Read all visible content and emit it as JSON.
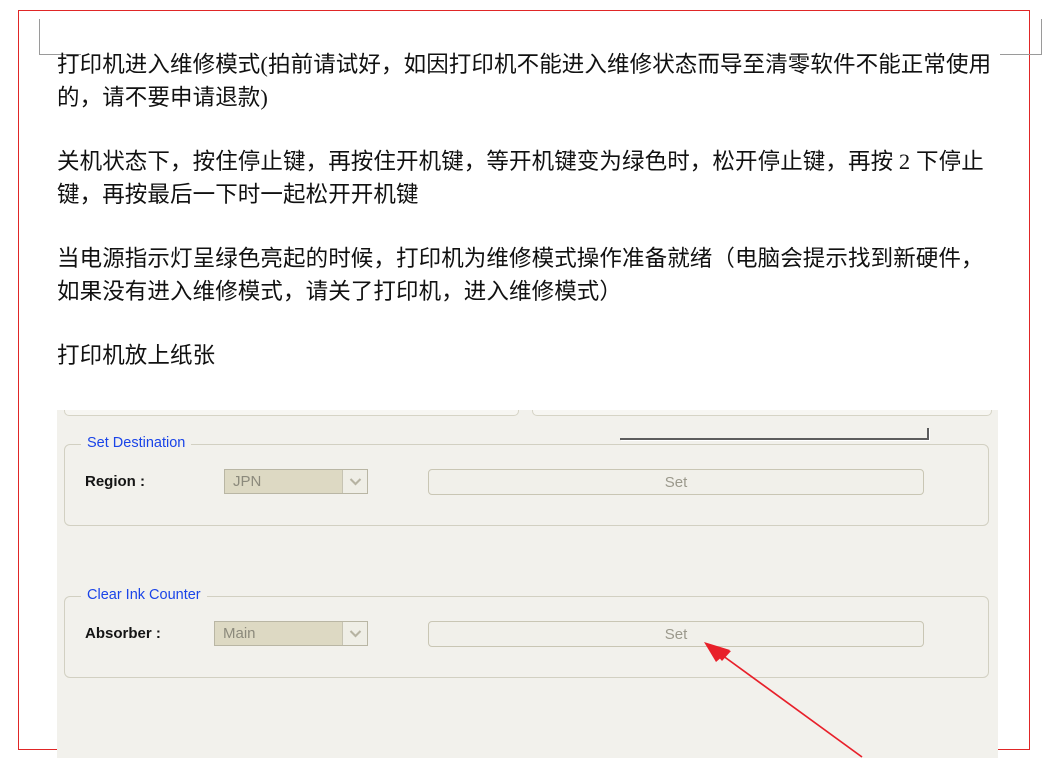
{
  "document": {
    "paragraphs": [
      "打印机进入维修模式(拍前请试好，如因打印机不能进入维修状态而导至清零软件不能正常使用的，请不要申请退款)",
      "关机状态下，按住停止键，再按住开机键，等开机键变为绿色时，松开停止键，再按 2 下停止键，再按最后一下时一起松开开机键",
      "当电源指示灯呈绿色亮起的时候，打印机为维修模式操作准备就绪（电脑会提示找到新硬件，如果没有进入维修模式，请关了打印机，进入维修模式）",
      "打印机放上纸张"
    ],
    "page_border_color": "#e02626",
    "margin_mark_color": "#9a9a9a"
  },
  "app_screenshot": {
    "background_color": "#f2f1ec",
    "groups": [
      {
        "title": "Set Destination",
        "title_color": "#1a44e8",
        "field_label": "Region :",
        "combo_value": "JPN",
        "combo_arrow_icon": "chevron-down-icon",
        "button_label": "Set"
      },
      {
        "title": "Clear Ink Counter",
        "title_color": "#1a44e8",
        "field_label": "Absorber :",
        "combo_value": "Main",
        "combo_arrow_icon": "chevron-down-icon",
        "button_label": "Set"
      }
    ]
  },
  "annotation": {
    "arrow_color": "#e8202a",
    "arrow_icon": "arrow-pointer-icon",
    "points_to": "Set"
  }
}
